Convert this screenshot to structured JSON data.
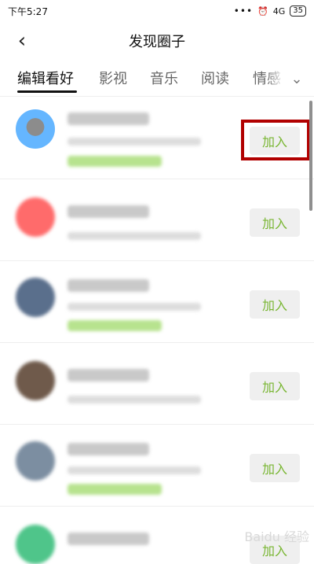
{
  "status_bar": {
    "time": "下午5:27",
    "signal": "4G",
    "battery": "35"
  },
  "header": {
    "title": "发现圈子"
  },
  "tabs": [
    {
      "label": "编辑看好"
    },
    {
      "label": "影视"
    },
    {
      "label": "音乐"
    },
    {
      "label": "阅读"
    },
    {
      "label": "情感"
    }
  ],
  "rows": [
    {
      "join_label": "加入"
    },
    {
      "join_label": "加入"
    },
    {
      "join_label": "加入"
    },
    {
      "join_label": "加入"
    },
    {
      "join_label": "加入"
    },
    {
      "join_label": "加入"
    }
  ],
  "watermark": "Baidu 经验",
  "colors": {
    "accent_green": "#79b632",
    "highlight_red": "#b10000"
  }
}
